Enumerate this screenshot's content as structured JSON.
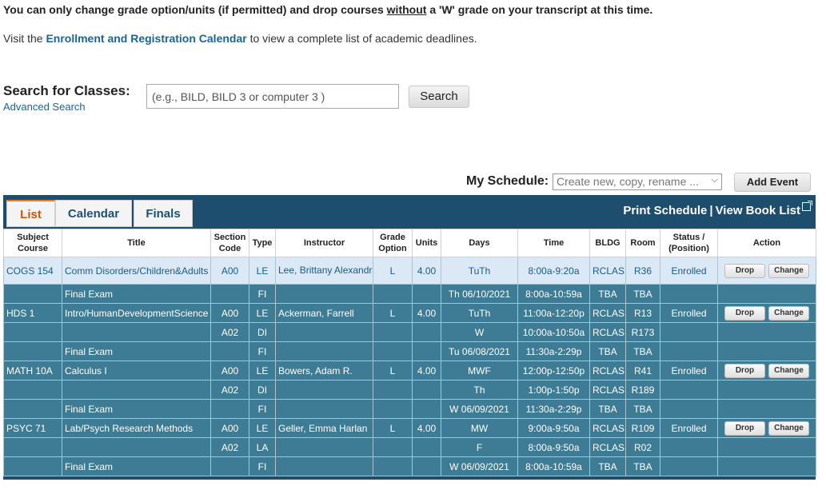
{
  "notice": {
    "before": "You can only change grade option/units (if permitted) and drop courses ",
    "underlined": "without",
    "after": " a 'W' grade on your transcript at this time."
  },
  "visit": {
    "before": "Visit the ",
    "link": "Enrollment and Registration Calendar",
    "after": " to view a complete list of academic deadlines."
  },
  "search": {
    "label": "Search for Classes:",
    "advanced": "Advanced Search",
    "placeholder": "(e.g., BILD, BILD 3 or computer 3 )",
    "button": "Search"
  },
  "schedule": {
    "label": "My Schedule:",
    "select_placeholder": "Create new, copy, rename ...",
    "add_event": "Add Event"
  },
  "tabs": [
    "List",
    "Calendar",
    "Finals"
  ],
  "print_links": {
    "print": "Print Schedule",
    "sep": "|",
    "book": "View Book List"
  },
  "columns": [
    "Subject Course",
    "Title",
    "Section Code",
    "Type",
    "Instructor",
    "Grade Option",
    "Units",
    "Days",
    "Time",
    "BLDG",
    "Room",
    "Status / (Position)",
    "Action"
  ],
  "actions": {
    "drop": "Drop",
    "change": "Change"
  },
  "rows": [
    {
      "subject": "COGS 154",
      "title": "Comm Disorders/Children&Adults",
      "section": "A00",
      "type": "LE",
      "instructor": "Lee, Brittany Alexandra",
      "grade": "L",
      "units": "4.00",
      "days": "TuTh",
      "time": "8:00a-9:20a",
      "bldg": "RCLAS",
      "room": "R36",
      "status": "Enrolled",
      "actions": true,
      "highlight": true
    },
    {
      "subject": "",
      "title": "Final Exam",
      "section": "",
      "type": "FI",
      "instructor": "",
      "grade": "",
      "units": "",
      "days": "Th 06/10/2021",
      "time": "8:00a-10:59a",
      "bldg": "TBA",
      "room": "TBA",
      "status": "",
      "actions": false
    },
    {
      "subject": "HDS 1",
      "title": "Intro/HumanDevelopmentScience",
      "section": "A00",
      "type": "LE",
      "instructor": "Ackerman, Farrell",
      "grade": "L",
      "units": "4.00",
      "days": "TuTh",
      "time": "11:00a-12:20p",
      "bldg": "RCLAS",
      "room": "R13",
      "status": "Enrolled",
      "actions": true
    },
    {
      "subject": "",
      "title": "",
      "section": "A02",
      "type": "DI",
      "instructor": "",
      "grade": "",
      "units": "",
      "days": "W",
      "time": "10:00a-10:50a",
      "bldg": "RCLAS",
      "room": "R173",
      "status": "",
      "actions": false
    },
    {
      "subject": "",
      "title": "Final Exam",
      "section": "",
      "type": "FI",
      "instructor": "",
      "grade": "",
      "units": "",
      "days": "Tu 06/08/2021",
      "time": "11:30a-2:29p",
      "bldg": "TBA",
      "room": "TBA",
      "status": "",
      "actions": false
    },
    {
      "subject": "MATH 10A",
      "title": "Calculus I",
      "section": "A00",
      "type": "LE",
      "instructor": "Bowers, Adam R.",
      "grade": "L",
      "units": "4.00",
      "days": "MWF",
      "time": "12:00p-12:50p",
      "bldg": "RCLAS",
      "room": "R41",
      "status": "Enrolled",
      "actions": true
    },
    {
      "subject": "",
      "title": "",
      "section": "A02",
      "type": "DI",
      "instructor": "",
      "grade": "",
      "units": "",
      "days": "Th",
      "time": "1:00p-1:50p",
      "bldg": "RCLAS",
      "room": "R189",
      "status": "",
      "actions": false
    },
    {
      "subject": "",
      "title": "Final Exam",
      "section": "",
      "type": "FI",
      "instructor": "",
      "grade": "",
      "units": "",
      "days": "W 06/09/2021",
      "time": "11:30a-2:29p",
      "bldg": "TBA",
      "room": "TBA",
      "status": "",
      "actions": false
    },
    {
      "subject": "PSYC 71",
      "title": "Lab/Psych Research Methods",
      "section": "A00",
      "type": "LE",
      "instructor": "Geller, Emma Harlan",
      "grade": "L",
      "units": "4.00",
      "days": "MW",
      "time": "9:00a-9:50a",
      "bldg": "RCLAS",
      "room": "R109",
      "status": "Enrolled",
      "actions": true
    },
    {
      "subject": "",
      "title": "",
      "section": "A02",
      "type": "LA",
      "instructor": "",
      "grade": "",
      "units": "",
      "days": "F",
      "time": "8:00a-9:50a",
      "bldg": "RCLAS",
      "room": "R02",
      "status": "",
      "actions": false
    },
    {
      "subject": "",
      "title": "Final Exam",
      "section": "",
      "type": "FI",
      "instructor": "",
      "grade": "",
      "units": "",
      "days": "W 06/09/2021",
      "time": "8:00a-10:59a",
      "bldg": "TBA",
      "room": "TBA",
      "status": "",
      "actions": false
    }
  ]
}
